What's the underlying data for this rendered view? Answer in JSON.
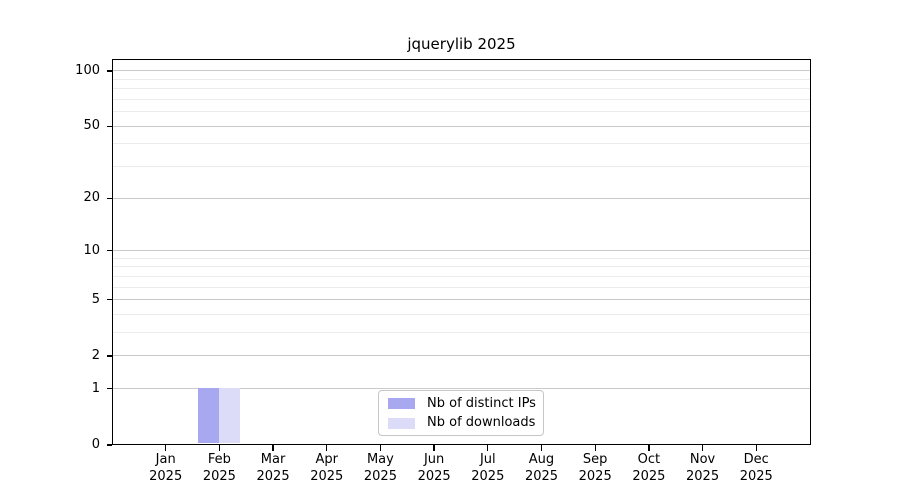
{
  "title": "jquerylib 2025",
  "chart_data": {
    "type": "bar",
    "title": "jquerylib 2025",
    "categories": [
      {
        "month": "Jan",
        "year": "2025"
      },
      {
        "month": "Feb",
        "year": "2025"
      },
      {
        "month": "Mar",
        "year": "2025"
      },
      {
        "month": "Apr",
        "year": "2025"
      },
      {
        "month": "May",
        "year": "2025"
      },
      {
        "month": "Jun",
        "year": "2025"
      },
      {
        "month": "Jul",
        "year": "2025"
      },
      {
        "month": "Aug",
        "year": "2025"
      },
      {
        "month": "Sep",
        "year": "2025"
      },
      {
        "month": "Oct",
        "year": "2025"
      },
      {
        "month": "Nov",
        "year": "2025"
      },
      {
        "month": "Dec",
        "year": "2025"
      }
    ],
    "series": [
      {
        "name": "Nb of distinct IPs",
        "color": "#a8a8f0",
        "values": [
          0,
          1,
          0,
          0,
          0,
          0,
          0,
          0,
          0,
          0,
          0,
          0
        ]
      },
      {
        "name": "Nb of downloads",
        "color": "#dcdcf8",
        "values": [
          0,
          1,
          0,
          0,
          0,
          0,
          0,
          0,
          0,
          0,
          0,
          0
        ]
      }
    ],
    "y_axis": {
      "scale": "log1p",
      "min": 0,
      "max": 116,
      "major_ticks": [
        100,
        50,
        20,
        10,
        5,
        2,
        1,
        0
      ],
      "minor_gridlines": [
        90,
        80,
        70,
        60,
        40,
        30,
        9,
        8,
        7,
        6,
        4,
        3
      ]
    },
    "xlabel": "",
    "ylabel": "",
    "grid": true,
    "legend_position": "lower center",
    "colors": {
      "major_grid": "#c9c9c9",
      "minor_grid": "#ececec",
      "spine": "#000000",
      "background": "#ffffff"
    }
  }
}
